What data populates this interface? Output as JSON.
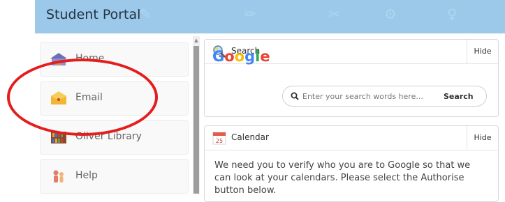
{
  "header": {
    "title": "Student Portal"
  },
  "sidebar": {
    "items": [
      {
        "label": "Home",
        "icon": "home-icon"
      },
      {
        "label": "Email",
        "icon": "email-icon"
      },
      {
        "label": "Oliver Library",
        "icon": "library-icon"
      },
      {
        "label": "Help",
        "icon": "help-icon"
      }
    ]
  },
  "search_panel": {
    "title": "Search",
    "hide_label": "Hide",
    "logo_text": "Google",
    "placeholder": "Enter your search words here...",
    "button_label": "Search"
  },
  "calendar_panel": {
    "title": "Calendar",
    "hide_label": "Hide",
    "date_icon_text": "25",
    "body_text": "We need you to verify who you are to Google so that we can look at your calendars. Please select the Authorise button below."
  },
  "annotation": {
    "color": "#e41e1e",
    "shape": "ellipse",
    "target": "Email"
  },
  "colors": {
    "header_bg": "#9cc9ea",
    "sidebar_item_bg": "#f9f9f9",
    "scroll_thumb": "#9d9d9d"
  }
}
